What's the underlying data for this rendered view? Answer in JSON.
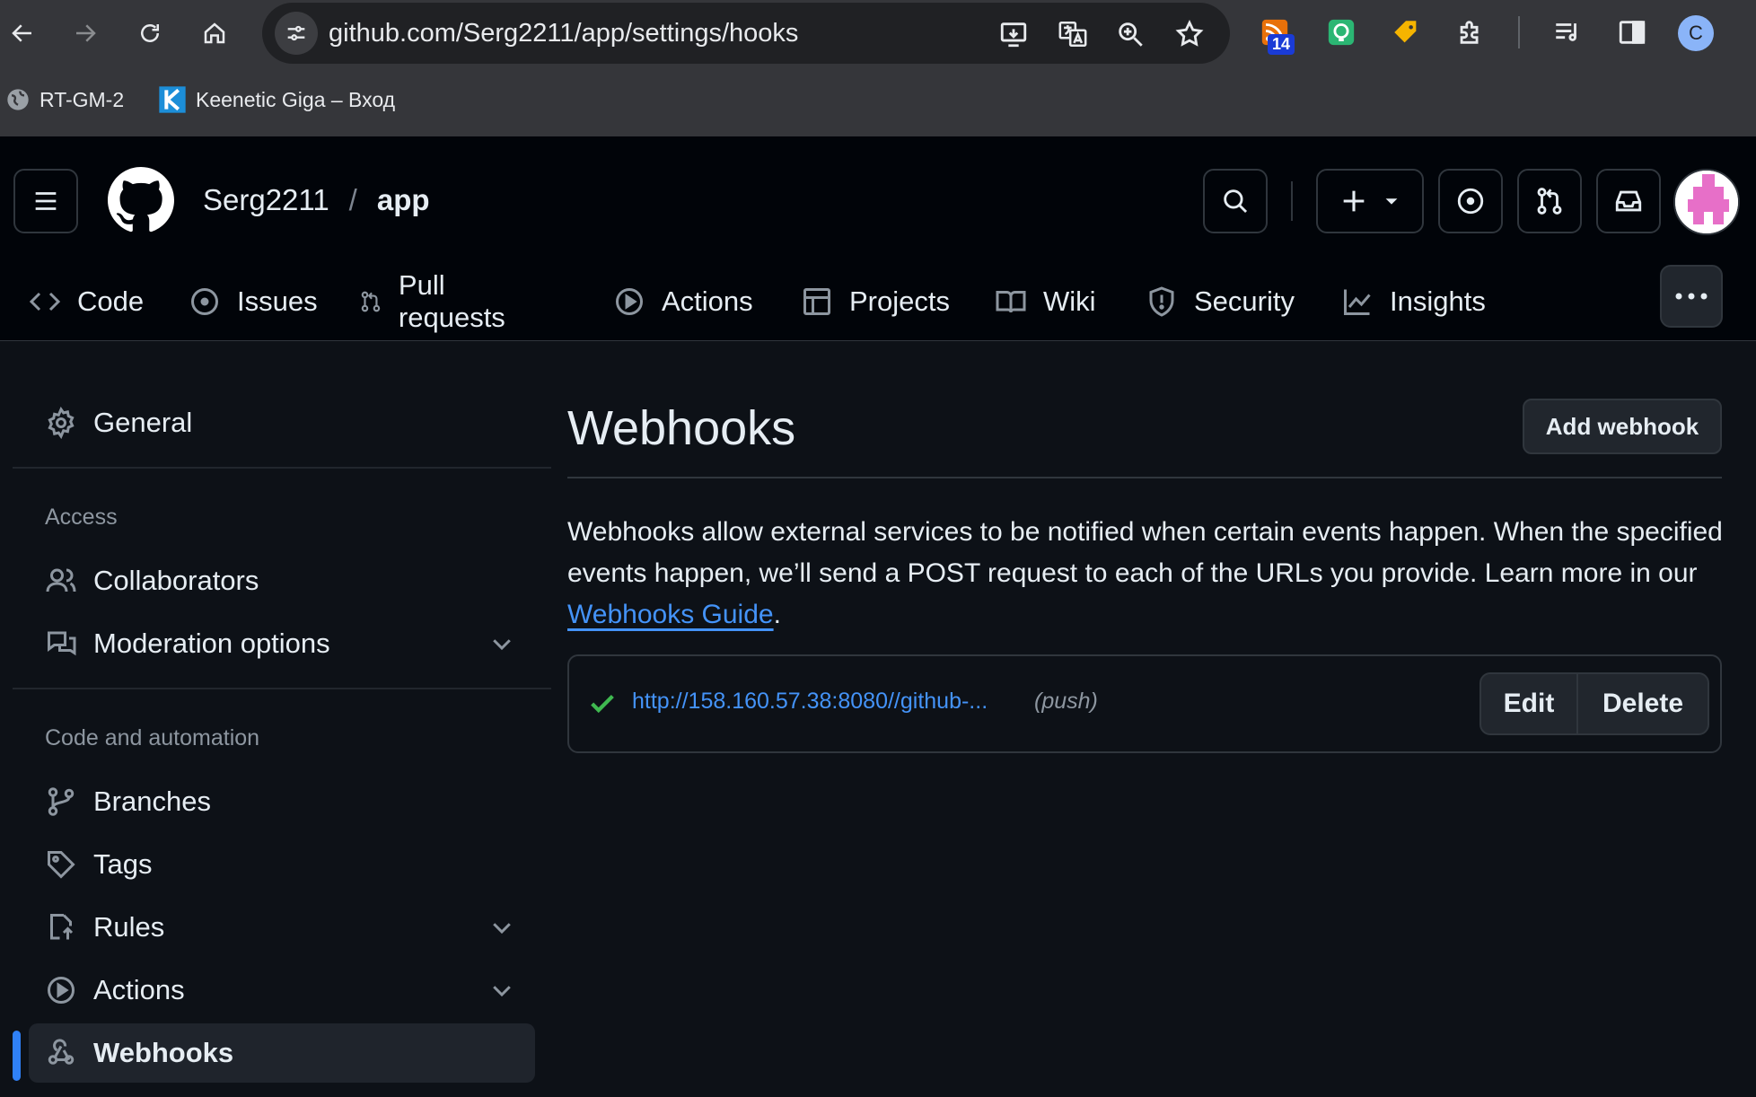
{
  "browser": {
    "url": "github.com/Serg2211/app/settings/hooks",
    "extension_badge": "14",
    "profile_initial": "C",
    "bookmarks": [
      "RT-GM-2",
      "Keenetic Giga – Вход"
    ]
  },
  "header": {
    "owner": "Serg2211",
    "separator": "/",
    "repo": "app"
  },
  "tabs": [
    "Code",
    "Issues",
    "Pull requests",
    "Actions",
    "Projects",
    "Wiki",
    "Security",
    "Insights"
  ],
  "sidebar": {
    "general": "General",
    "access_heading": "Access",
    "collaborators": "Collaborators",
    "moderation": "Moderation options",
    "automation_heading": "Code and automation",
    "branches": "Branches",
    "tags": "Tags",
    "rules": "Rules",
    "actions": "Actions",
    "webhooks": "Webhooks"
  },
  "main": {
    "title": "Webhooks",
    "add_button": "Add webhook",
    "description_prefix": "Webhooks allow external services to be notified when certain events happen. When the specified events happen, we’ll send a POST request to each of the URLs you provide. Learn more in our ",
    "guide_link": "Webhooks Guide",
    "description_suffix": ".",
    "hook": {
      "url": "http://158.160.57.38:8080//github-...",
      "event": "(push)",
      "edit": "Edit",
      "delete": "Delete"
    }
  },
  "colors": {
    "accent": "#2f81f7",
    "link": "#4493f8",
    "success": "#3fb950",
    "background": "#0d1117",
    "header_bg": "#010409"
  }
}
